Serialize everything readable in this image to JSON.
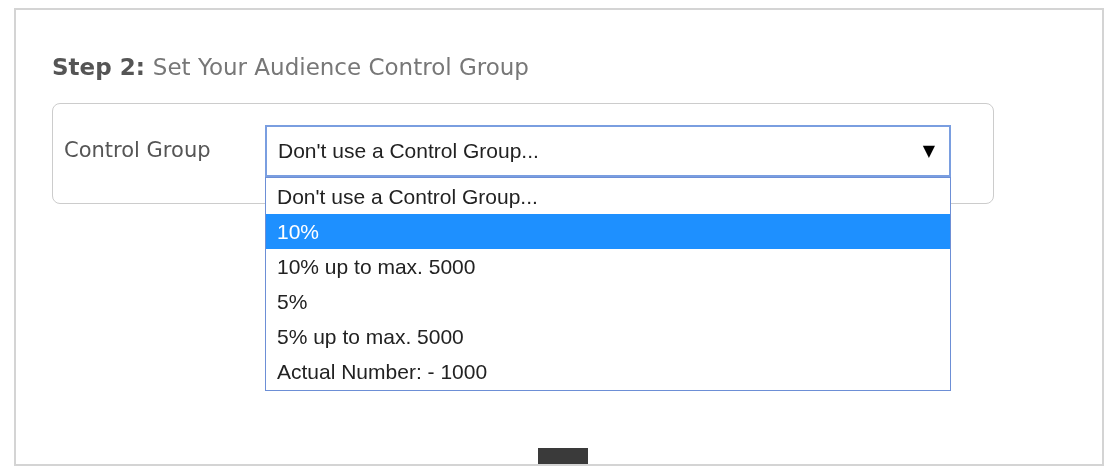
{
  "heading": {
    "step": "Step 2:",
    "title": "Set Your Audience Control Group"
  },
  "control_group": {
    "label": "Control Group",
    "value": "Don't use a Control Group...",
    "caret": "▼",
    "expanded": true,
    "options": [
      {
        "label": "Don't use a Control Group...",
        "highlighted": false
      },
      {
        "label": "10%",
        "highlighted": true
      },
      {
        "label": "10% up to max. 5000",
        "highlighted": false
      },
      {
        "label": "5%",
        "highlighted": false
      },
      {
        "label": "5% up to max. 5000",
        "highlighted": false
      },
      {
        "label": "Actual Number: - 1000",
        "highlighted": false
      }
    ]
  }
}
